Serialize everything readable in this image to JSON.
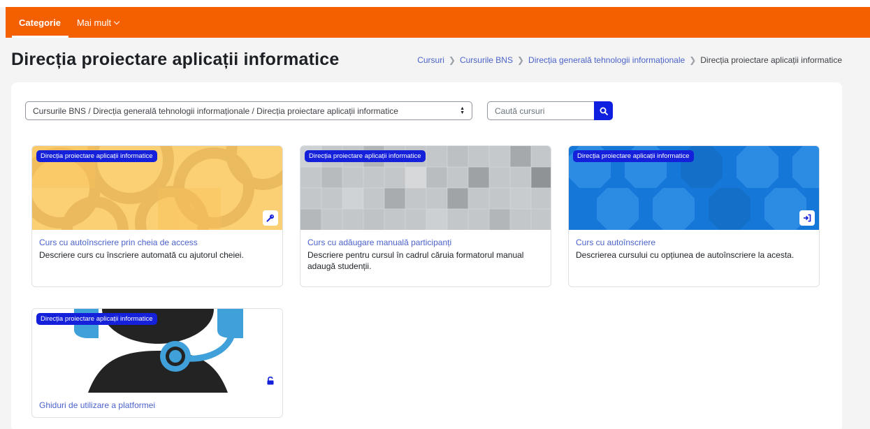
{
  "nav": {
    "tabs": [
      {
        "label": "Categorie"
      },
      {
        "label": "Mai mult"
      }
    ]
  },
  "page": {
    "title": "Direcția proiectare aplicații informatice"
  },
  "breadcrumb": {
    "items": [
      "Cursuri",
      "Cursurile BNS",
      "Direcția generală tehnologii informaționale",
      "Direcția proiectare aplicații informatice"
    ]
  },
  "filter": {
    "category_selected": "Cursurile BNS / Direcția generală tehnologii informaționale / Direcția proiectare aplicații informatice",
    "search_placeholder": "Caută cursuri"
  },
  "courses": [
    {
      "category": "Direcția proiectare aplicații informatice",
      "title": "Curs cu autoînscriere prin cheia de access",
      "description": "Descriere curs cu înscriere automată cu ajutorul cheiei.",
      "icon": "key-icon"
    },
    {
      "category": "Direcția proiectare aplicații informatice",
      "title": "Curs cu adăugare manuală participanți",
      "description": "Descriere pentru cursul în cadrul căruia formatorul manual adaugă studenții.",
      "icon": ""
    },
    {
      "category": "Direcția proiectare aplicații informatice",
      "title": "Curs cu autoînscriere",
      "description": "Descrierea cursului cu opțiunea de autoînscriere la acesta.",
      "icon": "sign-in-icon"
    },
    {
      "category": "Direcția proiectare aplicații informatice",
      "title": "Ghiduri de utilizare a platformei",
      "description": "",
      "icon": "unlock-icon"
    }
  ],
  "colors": {
    "brand": "#f46000",
    "accent": "#1420d9",
    "link": "#4b63c9"
  }
}
